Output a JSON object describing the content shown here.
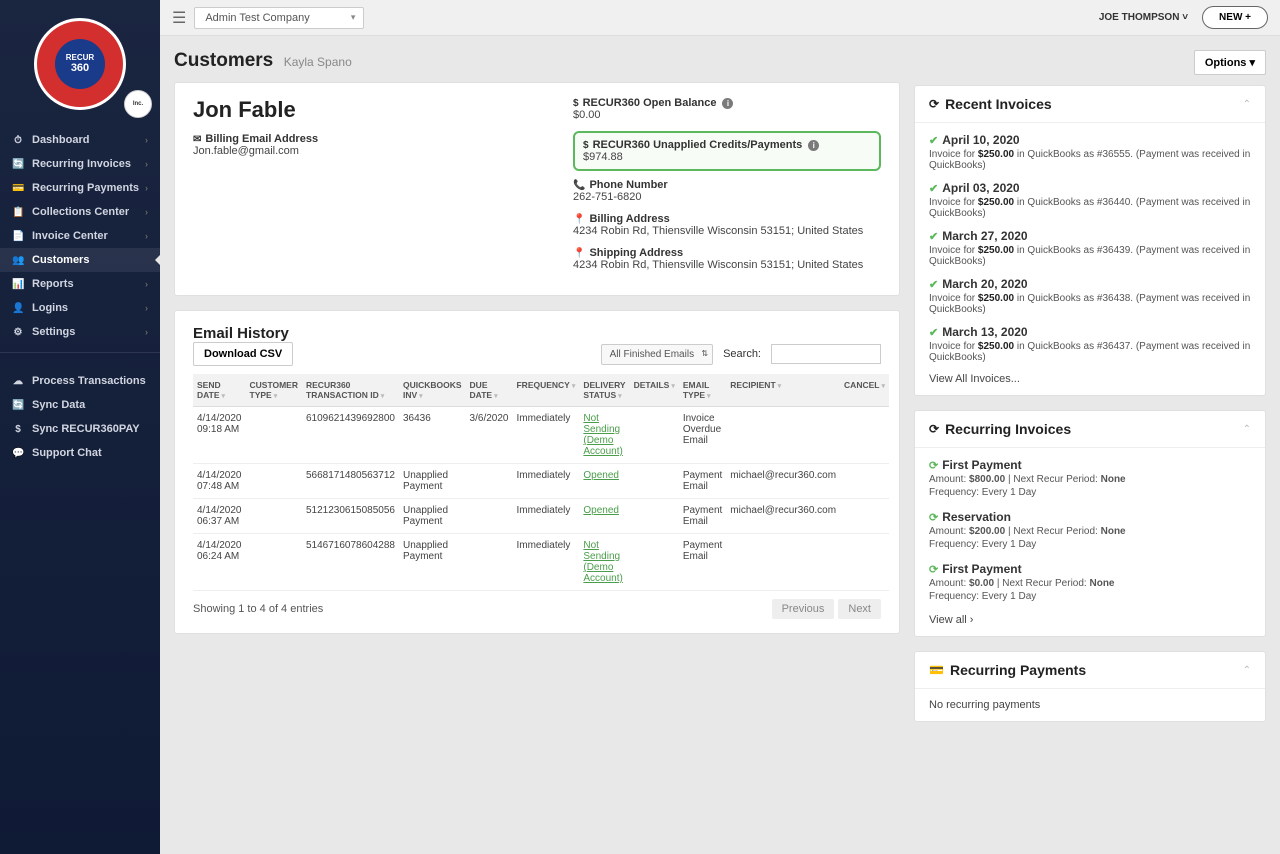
{
  "topbar": {
    "company": "Admin Test Company",
    "user": "JOE THOMPSON",
    "new_btn": "NEW +"
  },
  "sidebar": {
    "items": [
      {
        "icon": "⏱",
        "label": "Dashboard",
        "has_sub": true
      },
      {
        "icon": "🔄",
        "label": "Recurring Invoices",
        "has_sub": true
      },
      {
        "icon": "💳",
        "label": "Recurring Payments",
        "has_sub": true
      },
      {
        "icon": "📋",
        "label": "Collections Center",
        "has_sub": true
      },
      {
        "icon": "📄",
        "label": "Invoice Center",
        "has_sub": true
      },
      {
        "icon": "👥",
        "label": "Customers",
        "has_sub": false,
        "active": true
      },
      {
        "icon": "📊",
        "label": "Reports",
        "has_sub": true
      },
      {
        "icon": "👤",
        "label": "Logins",
        "has_sub": true
      },
      {
        "icon": "⚙",
        "label": "Settings",
        "has_sub": true
      }
    ],
    "items2": [
      {
        "icon": "☁",
        "label": "Process Transactions"
      },
      {
        "icon": "🔄",
        "label": "Sync Data"
      },
      {
        "icon": "$",
        "label": "Sync RECUR360PAY"
      },
      {
        "icon": "💬",
        "label": "Support Chat"
      }
    ]
  },
  "page": {
    "title": "Customers",
    "sub": "Kayla Spano",
    "options": "Options ▾"
  },
  "customer": {
    "name": "Jon Fable",
    "email_label": "Billing Email Address",
    "email": "Jon.fable@gmail.com",
    "open_balance_label": "RECUR360 Open Balance",
    "open_balance": "$0.00",
    "unapplied_label": "RECUR360 Unapplied Credits/Payments",
    "unapplied": "$974.88",
    "phone_label": "Phone Number",
    "phone": "262-751-6820",
    "billing_addr_label": "Billing Address",
    "billing_addr": "4234 Robin Rd, Thiensville Wisconsin 53151; United States",
    "shipping_addr_label": "Shipping Address",
    "shipping_addr": "4234 Robin Rd, Thiensville Wisconsin 53151; United States"
  },
  "email_history": {
    "title": "Email History",
    "download": "Download CSV",
    "filter": "All Finished Emails",
    "search_label": "Search:",
    "columns": [
      "SEND DATE",
      "CUSTOMER TYPE",
      "RECUR360 TRANSACTION ID",
      "QUICKBOOKS INV",
      "DUE DATE",
      "FREQUENCY",
      "DELIVERY STATUS",
      "DETAILS",
      "EMAIL TYPE",
      "RECIPIENT",
      "CANCEL"
    ],
    "rows": [
      {
        "send_date": "4/14/2020 09:18 AM",
        "cust_type": "",
        "txn": "6109621439692800",
        "qb": "36436",
        "due": "3/6/2020",
        "freq": "Immediately",
        "status": "Not Sending (Demo Account)",
        "details": "",
        "etype": "Invoice Overdue Email",
        "recipient": ""
      },
      {
        "send_date": "4/14/2020 07:48 AM",
        "cust_type": "",
        "txn": "5668171480563712",
        "qb": "Unapplied Payment",
        "due": "",
        "freq": "Immediately",
        "status": "Opened",
        "details": "",
        "etype": "Payment Email",
        "recipient": "michael@recur360.com"
      },
      {
        "send_date": "4/14/2020 06:37 AM",
        "cust_type": "",
        "txn": "5121230615085056",
        "qb": "Unapplied Payment",
        "due": "",
        "freq": "Immediately",
        "status": "Opened",
        "details": "",
        "etype": "Payment Email",
        "recipient": "michael@recur360.com"
      },
      {
        "send_date": "4/14/2020 06:24 AM",
        "cust_type": "",
        "txn": "5146716078604288",
        "qb": "Unapplied Payment",
        "due": "",
        "freq": "Immediately",
        "status": "Not Sending (Demo Account)",
        "details": "",
        "etype": "Payment Email",
        "recipient": ""
      }
    ],
    "showing": "Showing 1 to 4 of 4 entries",
    "prev": "Previous",
    "next": "Next"
  },
  "recent_invoices": {
    "title": "Recent Invoices",
    "items": [
      {
        "date": "April 10, 2020",
        "desc_pre": "Invoice for ",
        "amount": "$250.00",
        "desc_post": " in QuickBooks as #36555. (Payment was received in QuickBooks)"
      },
      {
        "date": "April 03, 2020",
        "desc_pre": "Invoice for ",
        "amount": "$250.00",
        "desc_post": " in QuickBooks as #36440. (Payment was received in QuickBooks)"
      },
      {
        "date": "March 27, 2020",
        "desc_pre": "Invoice for ",
        "amount": "$250.00",
        "desc_post": " in QuickBooks as #36439. (Payment was received in QuickBooks)"
      },
      {
        "date": "March 20, 2020",
        "desc_pre": "Invoice for ",
        "amount": "$250.00",
        "desc_post": " in QuickBooks as #36438. (Payment was received in QuickBooks)"
      },
      {
        "date": "March 13, 2020",
        "desc_pre": "Invoice for ",
        "amount": "$250.00",
        "desc_post": " in QuickBooks as #36437. (Payment was received in QuickBooks)"
      }
    ],
    "view_all": "View All Invoices..."
  },
  "recurring_invoices": {
    "title": "Recurring Invoices",
    "items": [
      {
        "name": "First Payment",
        "amount": "$800.00",
        "period": "None",
        "freq": "Every 1 Day"
      },
      {
        "name": "Reservation",
        "amount": "$200.00",
        "period": "None",
        "freq": "Every 1 Day"
      },
      {
        "name": "First Payment",
        "amount": "$0.00",
        "period": "None",
        "freq": "Every 1 Day"
      }
    ],
    "amount_label": "Amount: ",
    "period_label": " | Next Recur Period: ",
    "freq_label": "Frequency: ",
    "view_all": "View all ›"
  },
  "recurring_payments": {
    "title": "Recurring Payments",
    "empty": "No recurring payments"
  }
}
